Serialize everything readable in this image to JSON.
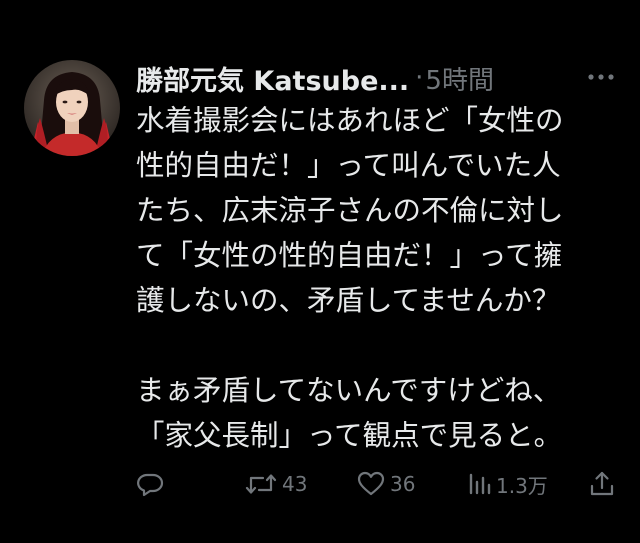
{
  "tweet": {
    "author": {
      "display_name": "勝部元気 Katsube...",
      "avatar_icon": "profile-photo"
    },
    "separator": "·",
    "timestamp": "5時間",
    "more_icon": "more-horizontal-icon",
    "body_lines": [
      "水着撮影会にはあれほど「女性の",
      "性的自由だ！」って叫んでいた人",
      "たち、広末涼子さんの不倫に対し",
      "て「女性の性的自由だ！」って擁",
      "護しないの、矛盾してませんか？",
      "",
      "まぁ矛盾してないんですけどね、",
      "「家父長制」って観点で見ると。"
    ],
    "actions": {
      "reply": {
        "icon": "reply-icon",
        "count": ""
      },
      "retweet": {
        "icon": "retweet-icon",
        "count": "43"
      },
      "like": {
        "icon": "heart-icon",
        "count": "36"
      },
      "views": {
        "icon": "views-chart-icon",
        "count": "1.3万"
      },
      "share": {
        "icon": "share-icon",
        "count": ""
      }
    },
    "colors": {
      "background": "#000000",
      "text_primary": "#e7e9ea",
      "text_secondary": "#71767b"
    }
  }
}
